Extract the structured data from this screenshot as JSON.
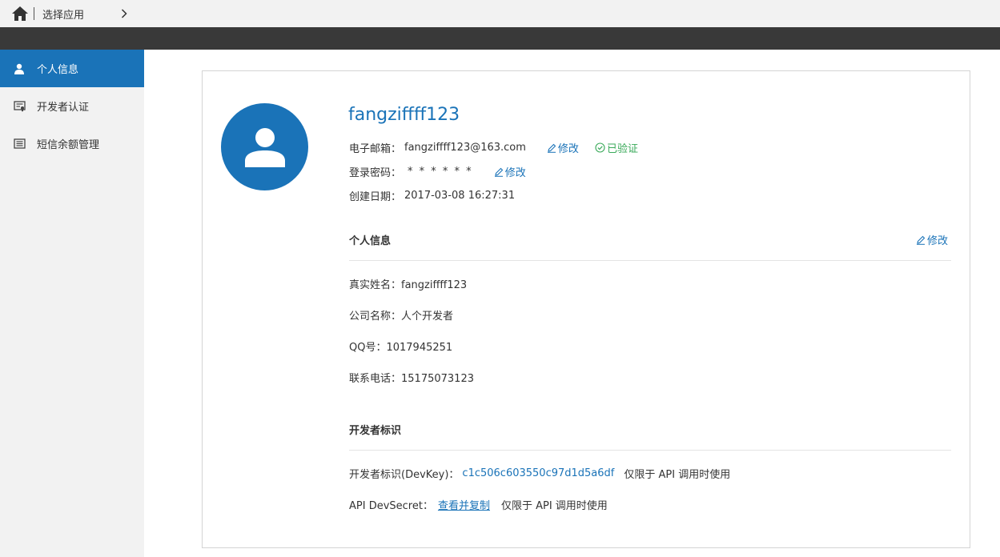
{
  "topbar": {
    "app_select_label": "选择应用",
    "home_icon": "home-icon",
    "chevron_icon": "chevron-right-icon"
  },
  "sidebar": {
    "items": [
      {
        "label": "个人信息",
        "icon": "user-icon",
        "active": true
      },
      {
        "label": "开发者认证",
        "icon": "certificate-icon",
        "active": false
      },
      {
        "label": "短信余额管理",
        "icon": "list-icon",
        "active": false
      }
    ]
  },
  "profile": {
    "username": "fangziffff123",
    "email_label": "电子邮箱：",
    "email_value": "fangziffff123@163.com",
    "email_edit": "修改",
    "email_verified": "已验证",
    "password_label": "登录密码：",
    "password_value": "* * * * * *",
    "password_edit": "修改",
    "created_label": "创建日期：",
    "created_value": "2017-03-08 16:27:31"
  },
  "personal": {
    "title": "个人信息",
    "edit": "修改",
    "real_name": "真实姓名：fangziffff123",
    "company": "公司名称：人个开发者",
    "qq": "QQ号：1017945251",
    "phone": "联系电话：15175073123"
  },
  "developer": {
    "title": "开发者标识",
    "devkey_label": "开发者标识(DevKey)：",
    "devkey_value": "c1c506c603550c97d1d5a6df",
    "devkey_note": "仅限于 API 调用时使用",
    "secret_label": "API DevSecret：",
    "secret_link": "查看并复制",
    "secret_note": "仅限于 API 调用时使用"
  },
  "colors": {
    "accent": "#1a73b8",
    "verified": "#3aaa5a",
    "darkbar": "#393939",
    "sidebar_bg": "#f2f2f2"
  }
}
